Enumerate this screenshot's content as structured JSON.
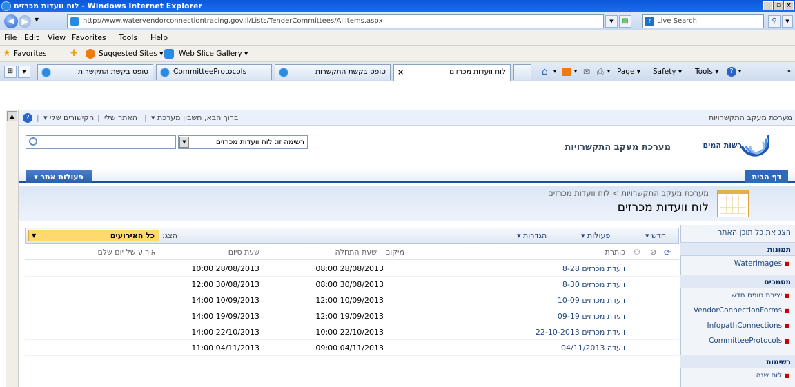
{
  "window": {
    "title": "לוח וועדות מכרזים - Windows Internet Explorer",
    "min": "_",
    "max": "▫",
    "close": "×"
  },
  "address_bar": {
    "url": "http://www.watervendorconnectiontracing.gov.il/Lists/TenderCommittees/AllItems.aspx",
    "search_placeholder": "Live Search"
  },
  "menu": [
    "File",
    "Edit",
    "View",
    "Favorites",
    "Tools",
    "Help"
  ],
  "favorites_bar": {
    "favorites": "Favorites",
    "suggested": "Suggested Sites ▾",
    "webslice": "Web Slice Gallery ▾"
  },
  "tabs": [
    {
      "label": "טופס בקשת התקשרות",
      "active": false
    },
    {
      "label": "CommitteeProtocols",
      "active": false
    },
    {
      "label": "טופס בקשת התקשרות",
      "active": false
    },
    {
      "label": "לוח וועדות מכרזים",
      "active": true
    }
  ],
  "command_bar": {
    "page": "Page ▾",
    "safety": "Safety ▾",
    "tools": "Tools ▾"
  },
  "sp": {
    "site_link": "מערכת מעקב התקשרויות",
    "welcome": "ברוך הבא, חשבון מערכת ▾",
    "my_site": "האתר שלי",
    "my_links": "הקישורים שלי ▾",
    "help_glyph": "?",
    "site_title": "מערכת מעקב התקשרויות",
    "logo_text": "רשות המים",
    "search_scope": "רשימה זו: לוח וועדות מכרזים",
    "home_tab": "דף הבית",
    "site_actions": "פעולות אתר ▾",
    "breadcrumb": "מערכת מעקב התקשרויות > לוח וועדות מכרזים",
    "page_title": "לוח וועדות מכרזים",
    "view_all": "הצג את כל תוכן האתר",
    "quicklaunch": {
      "pictures_header": "תמונות",
      "pictures": [
        "WaterImages"
      ],
      "docs_header": "מסמכים",
      "docs": [
        "יצירת טופס חדש",
        "VendorConnectionForms",
        "InfopathConnections",
        "CommitteeProtocols"
      ],
      "lists_header": "רשימות",
      "lists": [
        "לוח שנה"
      ]
    },
    "toolbar": {
      "new": "חדש ▾",
      "actions": "פעולות ▾",
      "settings": "הגדרות ▾",
      "view_label": "הצג:",
      "view_value": "כל האירועים"
    },
    "columns": {
      "title": "כותרת",
      "location": "מיקום",
      "start": "שעת התחלה",
      "end": "שעת סיום",
      "allday": "אירוע של יום שלם"
    },
    "rows": [
      {
        "title": "וועדת מכרזים 8-28",
        "start": "08:00 28/08/2013",
        "end": "10:00 28/08/2013"
      },
      {
        "title": "וועדת מכרזים 8-30",
        "start": "08:00 30/08/2013",
        "end": "12:00 30/08/2013"
      },
      {
        "title": "וועדת מכרזים 10-09",
        "start": "12:00 10/09/2013",
        "end": "14:00 10/09/2013"
      },
      {
        "title": "וועדת מכרזים 09-19",
        "start": "12:00 19/09/2013",
        "end": "14:00 19/09/2013"
      },
      {
        "title": "וועדת מכרזים 22-10-2013",
        "start": "10:00 22/10/2013",
        "end": "14:00 22/10/2013"
      },
      {
        "title": "וועדה 04/11/2013",
        "start": "09:00 04/11/2013",
        "end": "11:00 04/11/2013"
      }
    ]
  },
  "colors": {
    "title_bar": "#0a58d8",
    "accent": "#2f6ab8",
    "view_selector": "#ffd86e",
    "link": "#244a7e"
  }
}
